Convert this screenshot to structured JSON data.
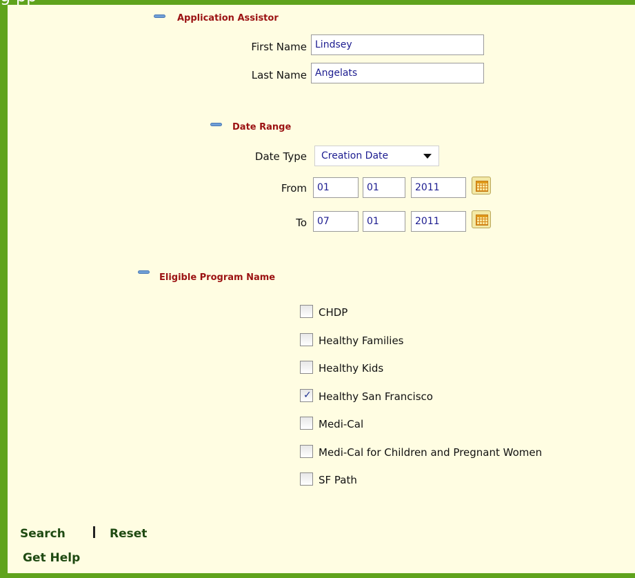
{
  "sections": {
    "applicant": {
      "title": "Application Assistor",
      "first_name_label": "First Name",
      "first_name_value": "Lindsey",
      "last_name_label": "Last Name",
      "last_name_value": "Angelats"
    },
    "date_range": {
      "title": "Date Range",
      "date_type_label": "Date Type",
      "date_type_value": "Creation Date",
      "from_label": "From",
      "from": {
        "month": "01",
        "day": "01",
        "year": "2011"
      },
      "to_label": "To",
      "to": {
        "month": "07",
        "day": "01",
        "year": "2011"
      }
    },
    "programs": {
      "title": "Eligible Program Name",
      "items": [
        {
          "label": "CHDP",
          "checked": false
        },
        {
          "label": "Healthy Families",
          "checked": false
        },
        {
          "label": "Healthy Kids",
          "checked": false
        },
        {
          "label": "Healthy San Francisco",
          "checked": true
        },
        {
          "label": "Medi-Cal",
          "checked": false
        },
        {
          "label": "Medi-Cal for Children and Pregnant Women",
          "checked": false
        },
        {
          "label": "SF Path",
          "checked": false
        }
      ]
    }
  },
  "actions": {
    "search": "Search",
    "reset": "Reset",
    "help": "Get Help"
  },
  "colors": {
    "frame": "#5fa31c",
    "panel": "#fffde2",
    "section_title": "#9b1212",
    "link": "#1f4a12",
    "input_text": "#1b1b8f"
  }
}
